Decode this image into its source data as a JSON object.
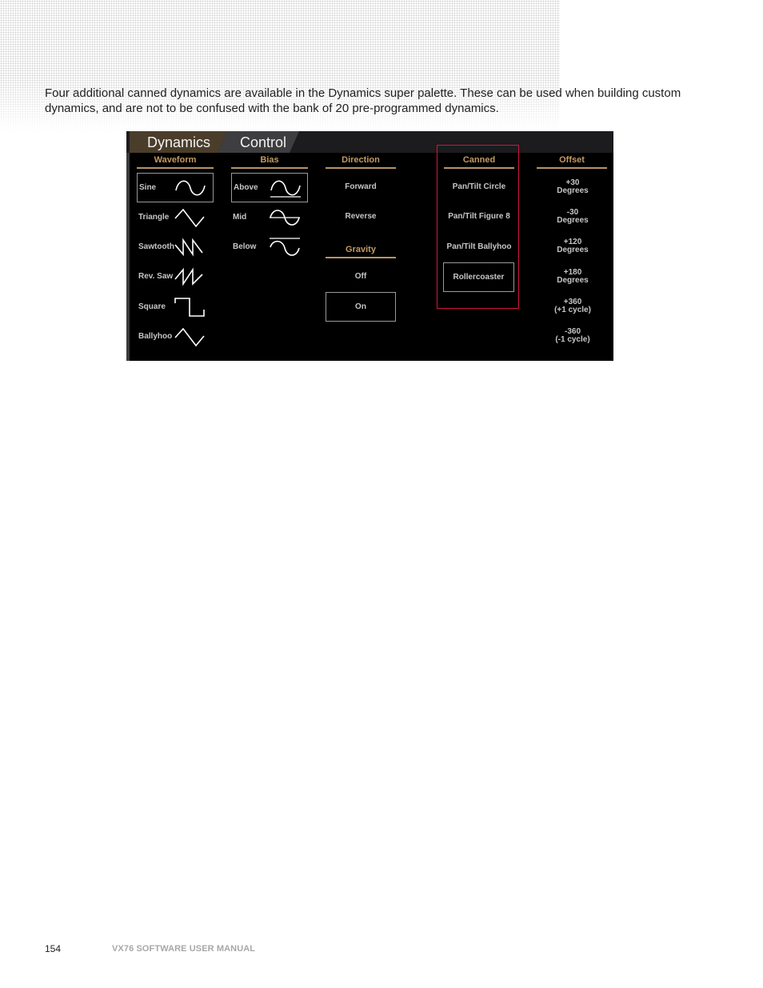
{
  "intro_text": "Four additional canned dynamics are available in the Dynamics super palette. These can be used when building custom dynamics, and are not to be confused with the bank of 20 pre-programmed dynamics.",
  "palette": {
    "tabs": [
      "Dynamics",
      "Control"
    ],
    "waveform": {
      "header": "Waveform",
      "items": [
        "Sine",
        "Triangle",
        "Sawtooth",
        "Rev. Saw",
        "Square",
        "Ballyhoo"
      ],
      "selected": "Sine"
    },
    "bias": {
      "header": "Bias",
      "items": [
        "Above",
        "Mid",
        "Below"
      ],
      "selected": "Above"
    },
    "direction": {
      "header": "Direction",
      "items": [
        "Forward",
        "Reverse"
      ]
    },
    "gravity": {
      "header": "Gravity",
      "items": [
        "Off",
        "On"
      ],
      "selected": "On"
    },
    "canned": {
      "header": "Canned",
      "items": [
        "Pan/Tilt Circle",
        "Pan/Tilt Figure 8",
        "Pan/Tilt Ballyhoo",
        "Rollercoaster"
      ],
      "selected": "Rollercoaster",
      "highlight_color": "#d4153e"
    },
    "offset": {
      "header": "Offset",
      "items": [
        {
          "value": "+30",
          "unit": "Degrees"
        },
        {
          "value": "-30",
          "unit": "Degrees"
        },
        {
          "value": "+120",
          "unit": "Degrees"
        },
        {
          "value": "+180",
          "unit": "Degrees"
        },
        {
          "value": "+360",
          "unit": "(+1 cycle)"
        },
        {
          "value": "-360",
          "unit": "(-1 cycle)"
        }
      ]
    },
    "accent_color": "#c49a62"
  },
  "footer": {
    "page_number": "154",
    "manual_title": "VX76 SOFTWARE USER MANUAL"
  }
}
